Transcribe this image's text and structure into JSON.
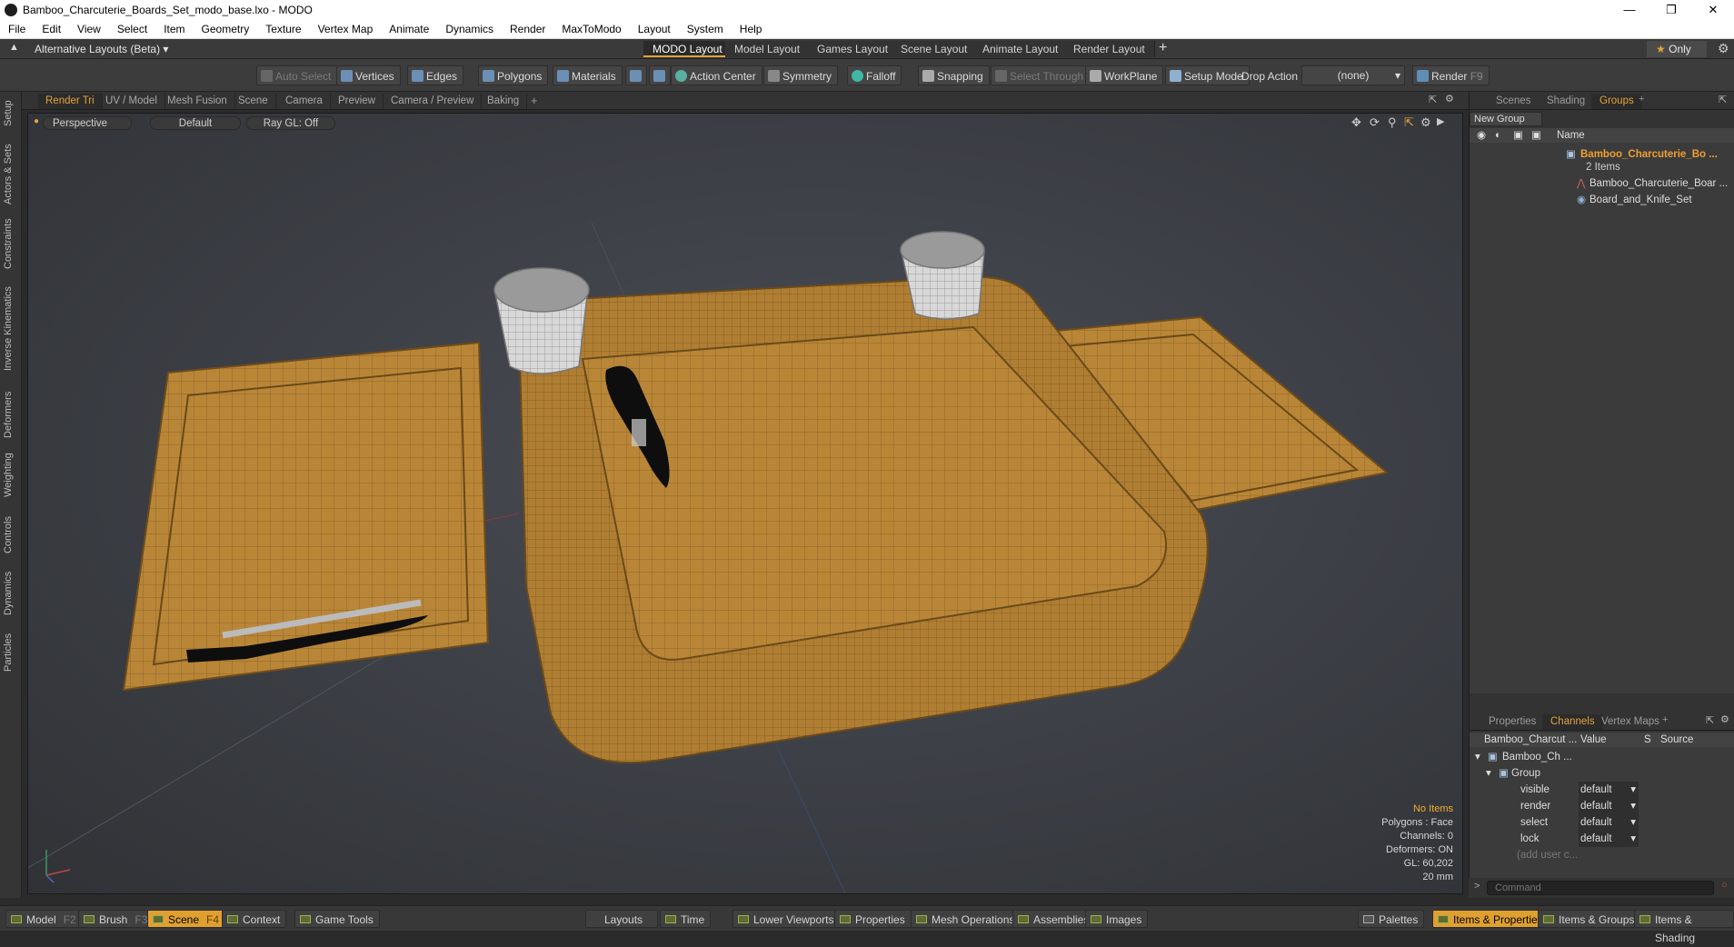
{
  "window": {
    "title": "Bamboo_Charcuterie_Boards_Set_modo_base.lxo - MODO"
  },
  "menu": [
    "File",
    "Edit",
    "View",
    "Select",
    "Item",
    "Geometry",
    "Texture",
    "Vertex Map",
    "Animate",
    "Dynamics",
    "Render",
    "MaxToModo",
    "Layout",
    "System",
    "Help"
  ],
  "layouts": {
    "selector": "Alternative Layouts (Beta)",
    "tabs": [
      "MODO Layout",
      "Model Layout",
      "Games Layout",
      "Scene Layout",
      "Animate Layout",
      "Render Layout"
    ],
    "only": "Only"
  },
  "toolbar": {
    "auto_select": "Auto Select",
    "vertices": "Vertices",
    "edges": "Edges",
    "polygons": "Polygons",
    "materials": "Materials",
    "action_center": "Action Center",
    "symmetry": "Symmetry",
    "falloff": "Falloff",
    "snapping": "Snapping",
    "select_through": "Select Through",
    "workplane": "WorkPlane",
    "setup_mode": "Setup Mode",
    "drop_action": "Drop Action",
    "drop_value": "(none)",
    "render": "Render",
    "render_key": "F9"
  },
  "left_tabs": [
    "Setup",
    "Actors & Sets",
    "Constraints",
    "Inverse Kinematics",
    "Deformers",
    "Weighting",
    "Controls",
    "Dynamics",
    "Particles"
  ],
  "viewport_tabs": [
    "Render Tri",
    "UV / Model",
    "Mesh Fusion",
    "Scene",
    "Camera",
    "Preview",
    "Camera / Preview",
    "Baking"
  ],
  "viewport": {
    "view": "Perspective",
    "shading": "Default",
    "raygl": "Ray GL: Off",
    "info": {
      "items": "No Items",
      "polygons": "Polygons : Face",
      "channels": "Channels: 0",
      "deformers": "Deformers: ON",
      "gl": "GL: 60,202",
      "scale": "20 mm"
    }
  },
  "right_top_tabs": [
    "Scenes",
    "Shading",
    "Groups"
  ],
  "groups": {
    "new_group": "New Group",
    "name_header": "Name",
    "root": "Bamboo_Charcuterie_Bo ...",
    "count": "2 Items",
    "children": [
      "Bamboo_Charcuterie_Boar ...",
      "Board_and_Knife_Set"
    ]
  },
  "right_bottom_tabs": [
    "Properties",
    "Channels",
    "Vertex Maps"
  ],
  "channels": {
    "headers": [
      "Bamboo_Charcut ...",
      "Value",
      "S",
      "Source"
    ],
    "item": "Bamboo_Ch ...",
    "group": "Group",
    "rows": [
      {
        "name": "visible",
        "value": "default"
      },
      {
        "name": "render",
        "value": "default"
      },
      {
        "name": "select",
        "value": "default"
      },
      {
        "name": "lock",
        "value": "default"
      }
    ],
    "add": "(add user c..."
  },
  "command": {
    "placeholder": "Command"
  },
  "bottom": {
    "model": "Model",
    "model_key": "F2",
    "brush": "Brush",
    "brush_key": "F3",
    "scene": "Scene",
    "scene_key": "F4",
    "context": "Context",
    "game_tools": "Game Tools",
    "layouts": "Layouts",
    "time": "Time",
    "lower_viewports": "Lower Viewports",
    "properties": "Properties",
    "mesh_operations": "Mesh Operations",
    "assemblies": "Assemblies",
    "images": "Images",
    "palettes": "Palettes",
    "items_properties": "Items & Properties",
    "items_groups": "Items & Groups",
    "items_shading": "Items & Shading"
  }
}
